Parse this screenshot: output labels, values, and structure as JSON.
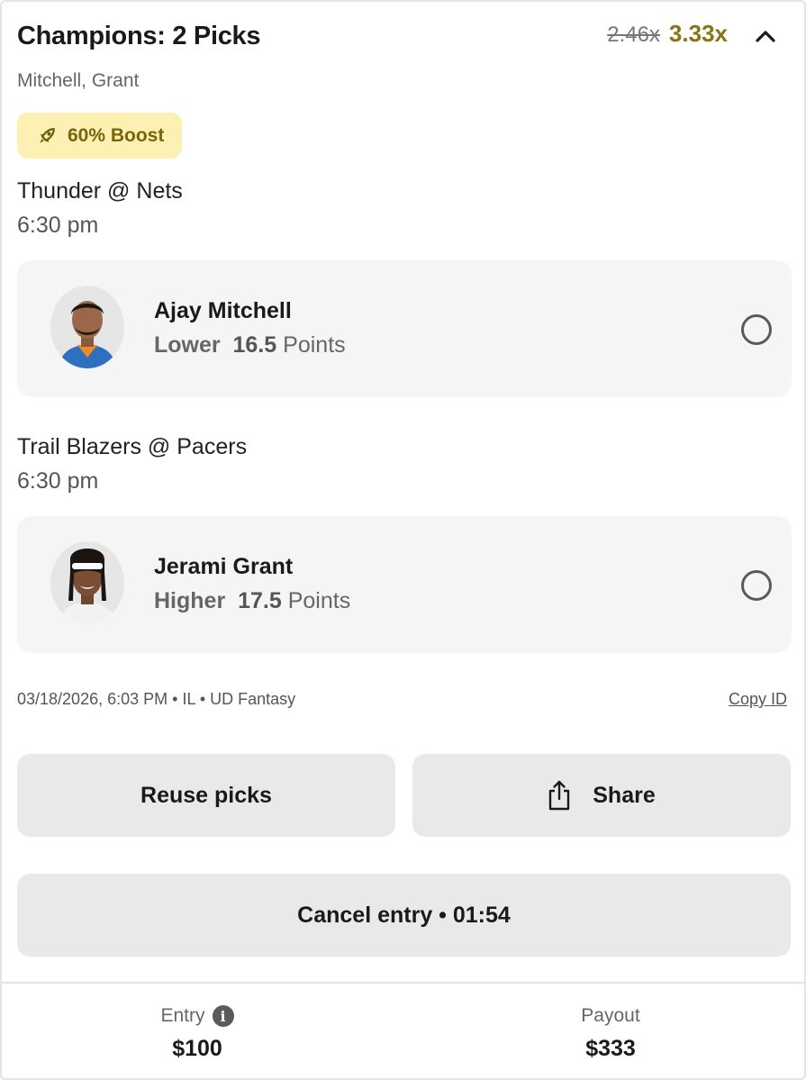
{
  "header": {
    "title": "Champions: 2 Picks",
    "old_multiplier": "2.46x",
    "new_multiplier": "3.33x",
    "collapse_icon": "chevron-up-icon"
  },
  "players_summary": "Mitchell, Grant",
  "boost": {
    "label": "60% Boost",
    "icon": "rocket-icon",
    "color": "#fdf0b3"
  },
  "games": [
    {
      "matchup": "Thunder @ Nets",
      "time": "6:30 pm",
      "pick": {
        "player": "Ajay Mitchell",
        "direction": "Lower",
        "value": "16.5",
        "stat": "Points"
      }
    },
    {
      "matchup": "Trail Blazers @ Pacers",
      "time": "6:30 pm",
      "pick": {
        "player": "Jerami Grant",
        "direction": "Higher",
        "value": "17.5",
        "stat": "Points"
      }
    }
  ],
  "meta": {
    "date": "03/18/2026, 6:03 PM",
    "state": "IL",
    "platform": "UD Fantasy",
    "copy_label": "Copy ID"
  },
  "actions": {
    "reuse_label": "Reuse picks",
    "share_label": "Share",
    "cancel_label": "Cancel entry • 01:54"
  },
  "footer": {
    "entry_label": "Entry",
    "entry_value": "$100",
    "payout_label": "Payout",
    "payout_value": "$333"
  },
  "colors": {
    "accent_gold": "#8a7311",
    "button_bg": "#e9e9e9",
    "card_bg": "#f5f5f5"
  }
}
